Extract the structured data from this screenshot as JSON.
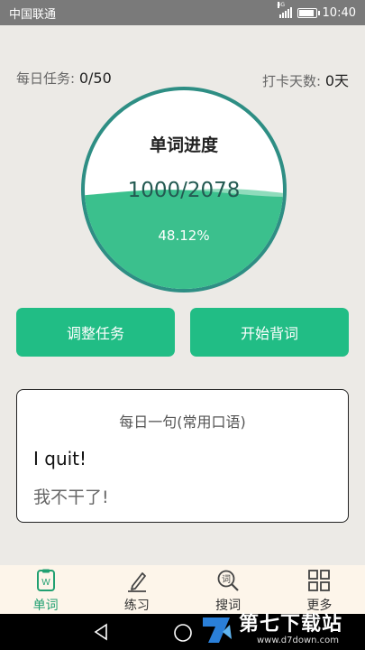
{
  "status_bar": {
    "carrier": "中国联通",
    "network_tag": "4G",
    "time": "10:40",
    "battery_level": 0.9
  },
  "stats": {
    "daily_task_label": "每日任务: ",
    "daily_task_value": "0/50",
    "checkin_label": "打卡天数: ",
    "checkin_value": "0天"
  },
  "progress": {
    "title": "单词进度",
    "count": "1000/2078",
    "percent": "48.12%",
    "fraction": 0.4812,
    "colors": {
      "ring": "#2e8e84",
      "wave_front": "#3bc08d",
      "wave_back": "#8fdcbc"
    }
  },
  "buttons": {
    "adjust": "调整任务",
    "start": "开始背词",
    "color": "#21bd85"
  },
  "quote": {
    "title": "每日一句(常用口语)",
    "english": "I quit!",
    "chinese": "我不干了!"
  },
  "tabs": [
    {
      "label": "单词",
      "icon": "word-book-icon",
      "active": true
    },
    {
      "label": "练习",
      "icon": "pen-practice-icon",
      "active": false
    },
    {
      "label": "搜词",
      "icon": "search-word-icon",
      "active": false
    },
    {
      "label": "更多",
      "icon": "grid-more-icon",
      "active": false
    }
  ],
  "navigation": {
    "icons": [
      "back-icon",
      "home-icon",
      "recents-icon"
    ]
  },
  "watermark": {
    "name": "第七下载站",
    "url": "www.d7down.com"
  }
}
